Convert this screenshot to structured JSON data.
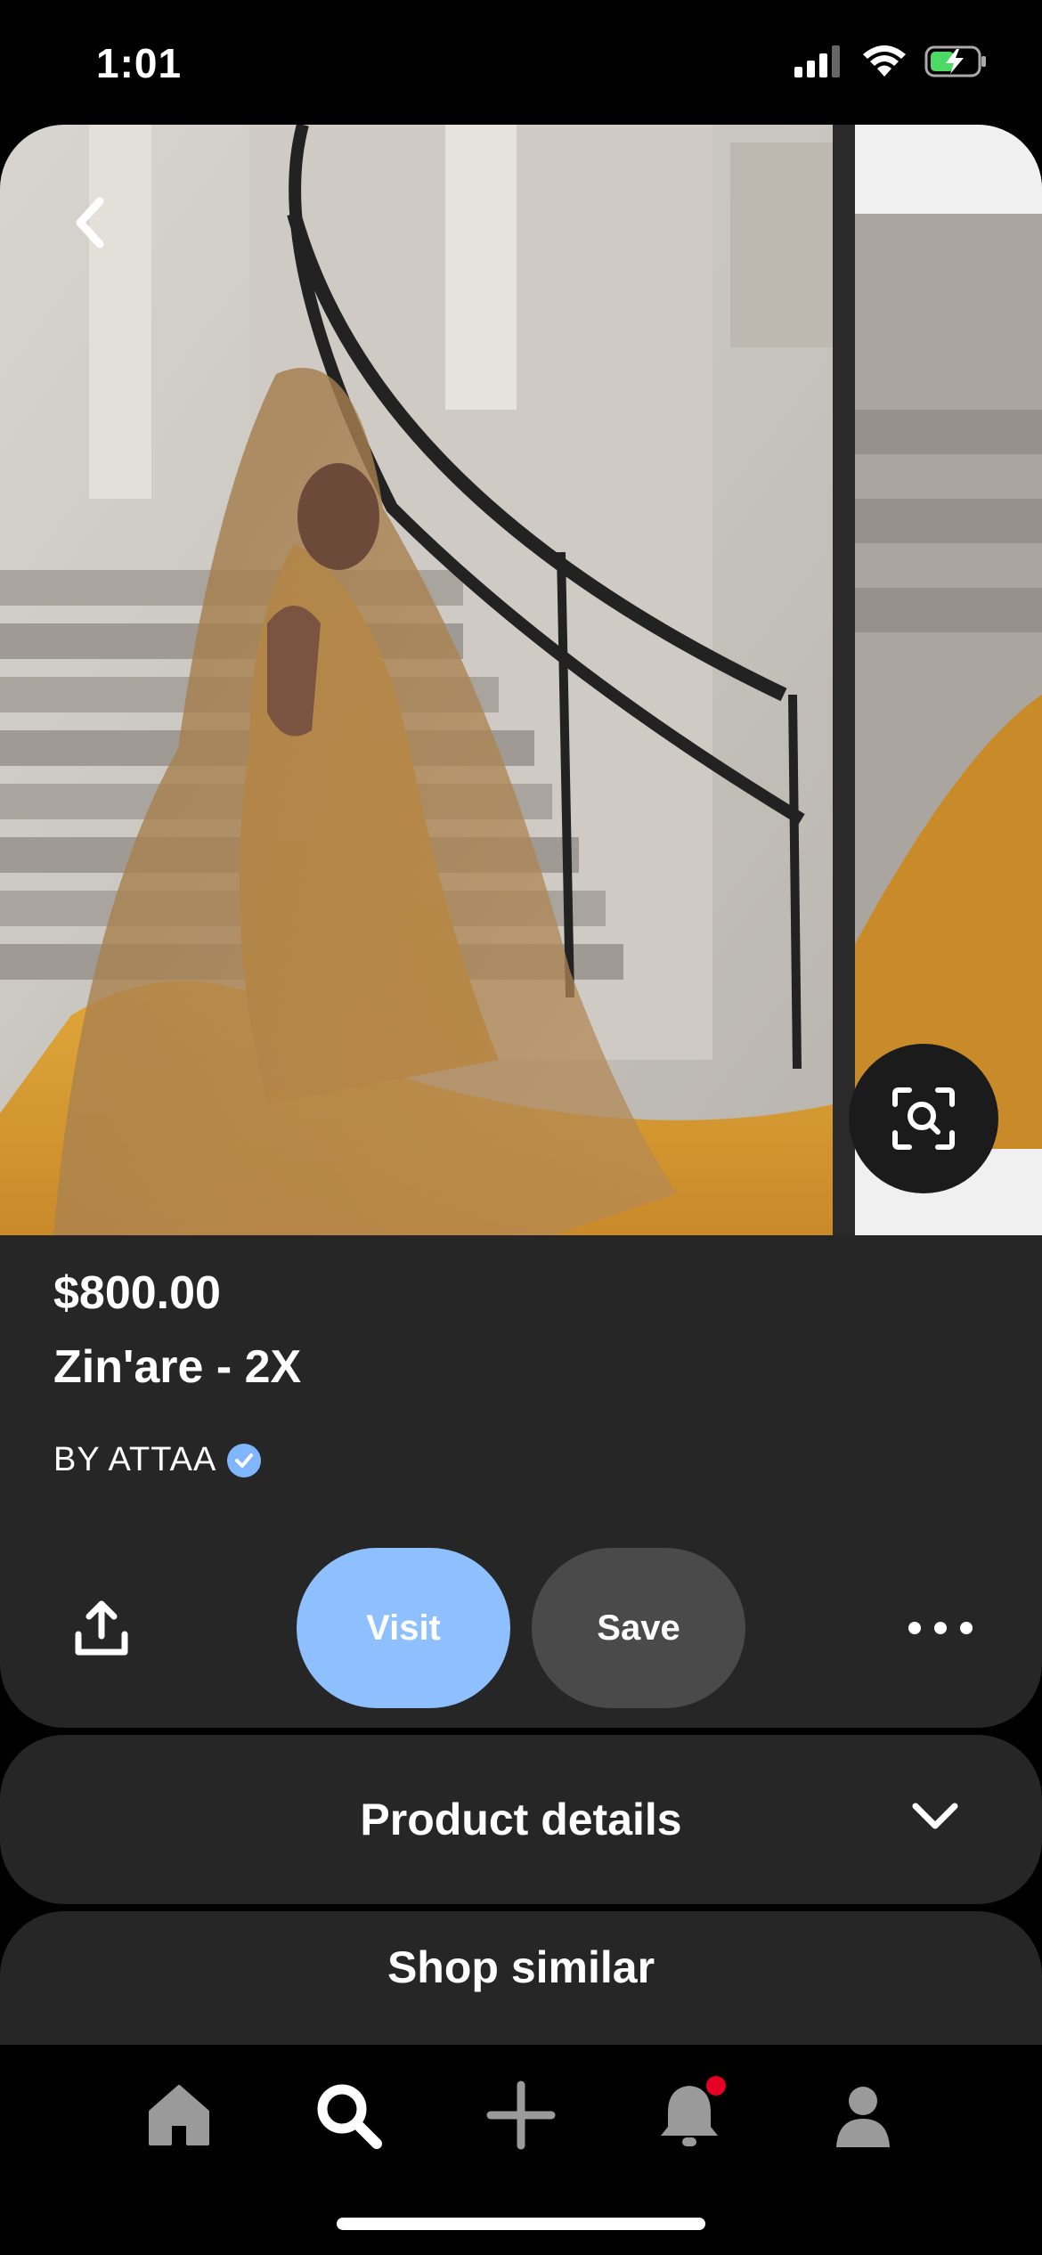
{
  "status_bar": {
    "time": "1:01"
  },
  "pin": {
    "price": "$800.00",
    "title": "Zin'are - 2X",
    "seller": "BY ATTAA"
  },
  "actions": {
    "visit_label": "Visit",
    "save_label": "Save"
  },
  "sections": {
    "product_details": "Product details",
    "shop_similar": "Shop similar"
  },
  "bottom_nav": [
    "home-icon",
    "search-icon",
    "plus-icon",
    "bell-icon",
    "profile-icon"
  ],
  "colors": {
    "visit": "#8ec0ff",
    "save": "#4a4a4a",
    "card": "#262626",
    "notification": "#e60023",
    "verified": "#7fb6ff"
  }
}
